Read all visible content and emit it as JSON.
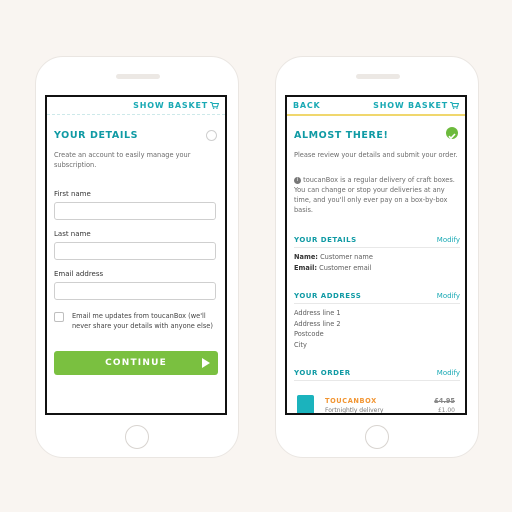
{
  "left_screen": {
    "show_basket": "SHOW BASKET",
    "title": "YOUR DETAILS",
    "subtitle": "Create an account to easily manage your subscription.",
    "fields": [
      {
        "label": "First name",
        "value": "",
        "placeholder": ""
      },
      {
        "label": "Last name",
        "value": "",
        "placeholder": ""
      },
      {
        "label": "Email address",
        "value": "",
        "placeholder": ""
      }
    ],
    "email_opt_in": {
      "label": "Email me updates from toucanBox (we'll never share your details with anyone else)",
      "checked": false
    },
    "continue_label": "CONTINUE"
  },
  "right_screen": {
    "back": "BACK",
    "show_basket": "SHOW BASKET",
    "title": "ALMOST THERE!",
    "instructions": "Please review your details and submit your order.",
    "info": "toucanBox is a regular delivery of craft boxes. You can change or stop your deliveries at any time, and you'll only ever pay on a box-by-box basis.",
    "details": {
      "heading": "YOUR DETAILS",
      "modify": "Modify",
      "name_label": "Name:",
      "name_value": "Customer name",
      "email_label": "Email:",
      "email_value": "Customer email"
    },
    "address": {
      "heading": "YOUR ADDRESS",
      "modify": "Modify",
      "lines": [
        "Address line 1",
        "Address line 2",
        "Postcode",
        "City"
      ]
    },
    "order": {
      "heading": "YOUR ORDER",
      "modify": "Modify",
      "item_name": "TOUCANBOX",
      "item_sub": "Fortnightly delivery",
      "price_old": "£4.95",
      "price_new": "£1.00"
    }
  },
  "colors": {
    "teal": "#0f9aa4",
    "green": "#7ac040",
    "orange": "#f29532",
    "yellow_underline": "#f0d76d"
  },
  "icons": [
    "cart-icon",
    "info-icon",
    "check-circle-icon",
    "play-icon",
    "toucanbox-product-icon"
  ]
}
